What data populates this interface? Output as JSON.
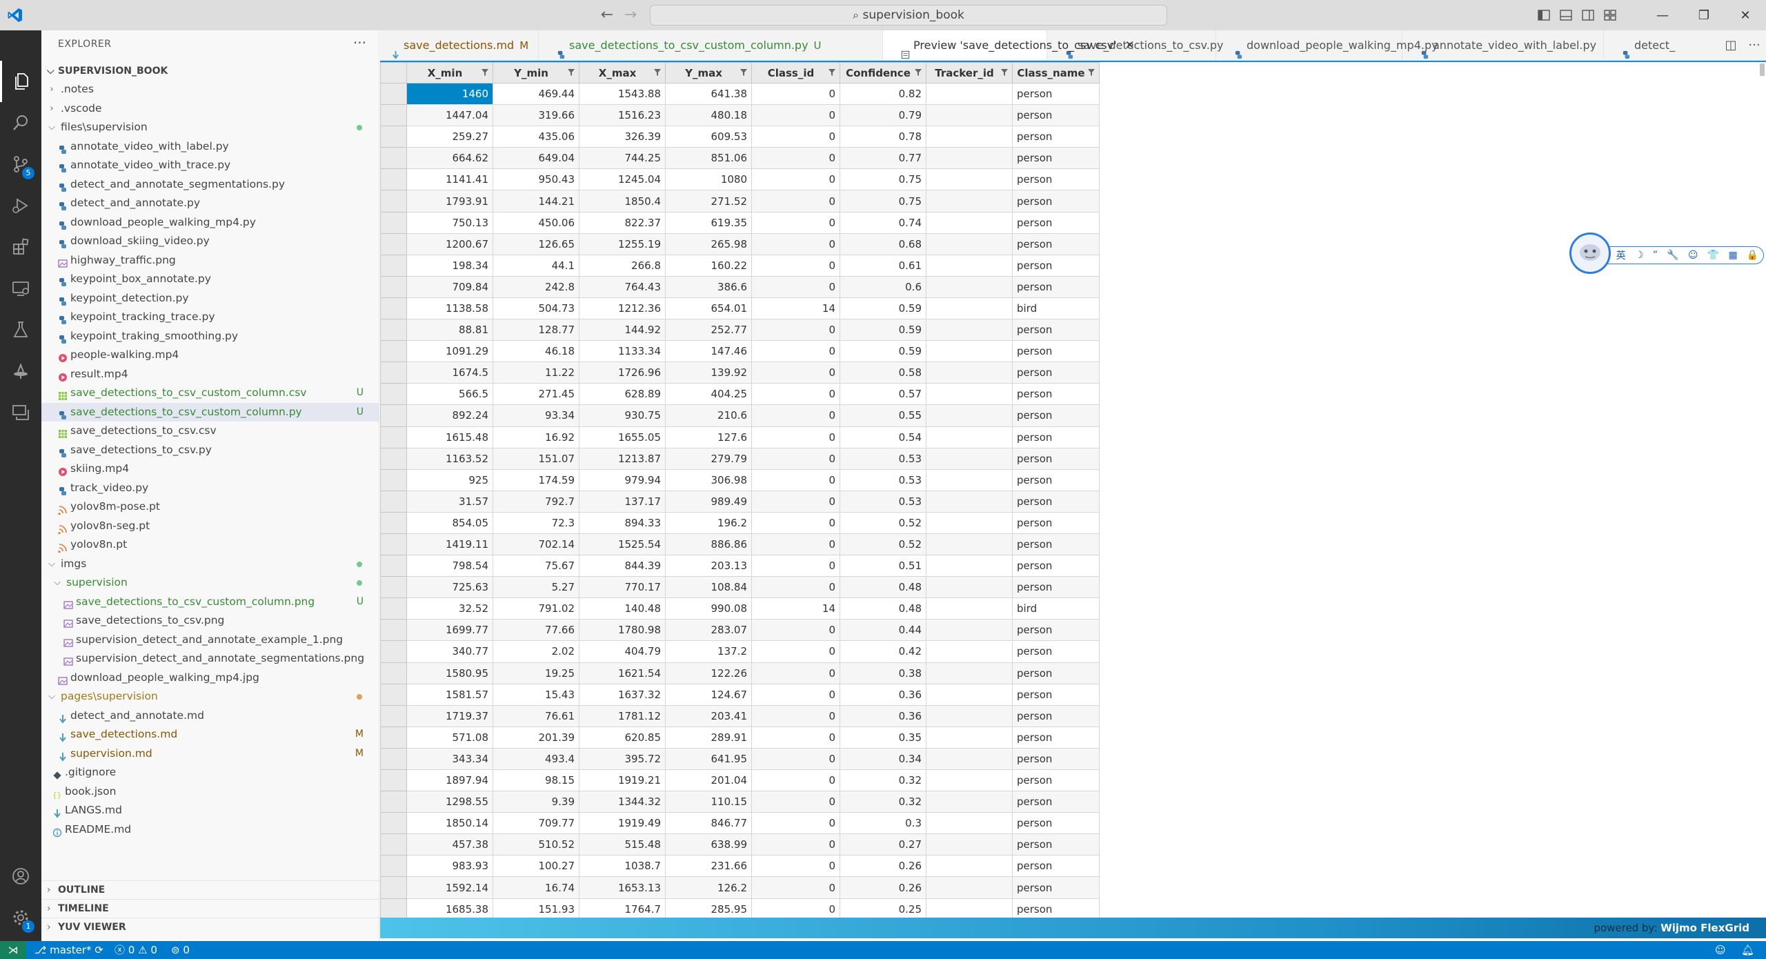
{
  "titlebar": {
    "search_text": "supervision_book"
  },
  "activity_bar": {
    "source_control_badge": "5",
    "accounts_badge": "1"
  },
  "sidebar": {
    "header": "EXPLORER",
    "more": "···",
    "workspace": "SUPERVISION_BOOK",
    "items": [
      {
        "label": ".notes",
        "type": "folder-closed",
        "level": 1
      },
      {
        "label": ".vscode",
        "type": "folder-closed",
        "level": 1
      },
      {
        "label": "files\\supervision",
        "type": "folder-open",
        "level": 1,
        "dot": "green"
      },
      {
        "label": "annotate_video_with_label.py",
        "type": "py",
        "level": 2
      },
      {
        "label": "annotate_video_with_trace.py",
        "type": "py",
        "level": 2
      },
      {
        "label": "detect_and_annotate_segmentations.py",
        "type": "py",
        "level": 2
      },
      {
        "label": "detect_and_annotate.py",
        "type": "py",
        "level": 2
      },
      {
        "label": "download_people_walking_mp4.py",
        "type": "py",
        "level": 2
      },
      {
        "label": "download_skiing_video.py",
        "type": "py",
        "level": 2
      },
      {
        "label": "highway_traffic.png",
        "type": "img",
        "level": 2
      },
      {
        "label": "keypoint_box_annotate.py",
        "type": "py",
        "level": 2
      },
      {
        "label": "keypoint_detection.py",
        "type": "py",
        "level": 2
      },
      {
        "label": "keypoint_tracking_trace.py",
        "type": "py",
        "level": 2
      },
      {
        "label": "keypoint_traking_smoothing.py",
        "type": "py",
        "level": 2
      },
      {
        "label": "people-walking.mp4",
        "type": "mp4",
        "level": 2
      },
      {
        "label": "result.mp4",
        "type": "mp4",
        "level": 2
      },
      {
        "label": "save_detections_to_csv_custom_column.csv",
        "type": "csv",
        "level": 2,
        "status": "U",
        "color": "green"
      },
      {
        "label": "save_detections_to_csv_custom_column.py",
        "type": "py",
        "level": 2,
        "status": "U",
        "color": "green",
        "selected": true
      },
      {
        "label": "save_detections_to_csv.csv",
        "type": "csv",
        "level": 2
      },
      {
        "label": "save_detections_to_csv.py",
        "type": "py",
        "level": 2
      },
      {
        "label": "skiing.mp4",
        "type": "mp4",
        "level": 2
      },
      {
        "label": "track_video.py",
        "type": "py",
        "level": 2
      },
      {
        "label": "yolov8m-pose.pt",
        "type": "pt",
        "level": 2
      },
      {
        "label": "yolov8n-seg.pt",
        "type": "pt",
        "level": 2
      },
      {
        "label": "yolov8n.pt",
        "type": "pt",
        "level": 2
      },
      {
        "label": "imgs",
        "type": "folder-open",
        "level": 1,
        "dot": "green"
      },
      {
        "label": "supervision",
        "type": "folder-open",
        "level": 2,
        "dot": "green",
        "color": "green"
      },
      {
        "label": "save_detections_to_csv_custom_column.png",
        "type": "img",
        "level": 3,
        "status": "U",
        "color": "green"
      },
      {
        "label": "save_detections_to_csv.png",
        "type": "img",
        "level": 3
      },
      {
        "label": "supervision_detect_and_annotate_example_1.png",
        "type": "img",
        "level": 3
      },
      {
        "label": "supervision_detect_and_annotate_segmentations.png",
        "type": "img",
        "level": 3
      },
      {
        "label": "download_people_walking_mp4.jpg",
        "type": "img",
        "level": 2
      },
      {
        "label": "pages\\supervision",
        "type": "folder-open",
        "level": 1,
        "dot": "mod",
        "color": "folder-mod"
      },
      {
        "label": "detect_and_annotate.md",
        "type": "md",
        "level": 2
      },
      {
        "label": "save_detections.md",
        "type": "md",
        "level": 2,
        "status": "M",
        "color": "mod"
      },
      {
        "label": "supervision.md",
        "type": "md",
        "level": 2,
        "status": "M",
        "color": "mod"
      },
      {
        "label": ".gitignore",
        "type": "git",
        "level": 1
      },
      {
        "label": "book.json",
        "type": "json",
        "level": 1
      },
      {
        "label": "LANGS.md",
        "type": "md",
        "level": 1
      },
      {
        "label": "README.md",
        "type": "info",
        "level": 1
      }
    ],
    "sections": [
      "OUTLINE",
      "TIMELINE",
      "YUV VIEWER"
    ]
  },
  "tabs": [
    {
      "label": "save_detections.md",
      "status": "M",
      "type": "md"
    },
    {
      "label": "save_detections_to_csv_custom_column.py",
      "status": "U",
      "type": "py"
    },
    {
      "label": "Preview 'save_detections_to_csv.csv'",
      "status": "",
      "type": "preview",
      "active": true
    },
    {
      "label": "save_detections_to_csv.py",
      "status": "",
      "type": "py"
    },
    {
      "label": "download_people_walking_mp4.py",
      "status": "",
      "type": "py"
    },
    {
      "label": "annotate_video_with_label.py",
      "status": "",
      "type": "py"
    },
    {
      "label": "detect_",
      "status": "",
      "type": "py"
    }
  ],
  "grid": {
    "columns": [
      "X_min",
      "Y_min",
      "X_max",
      "Y_max",
      "Class_id",
      "Confidence",
      "Tracker_id",
      "Class_name"
    ],
    "rows": [
      [
        "1460",
        "469.44",
        "1543.88",
        "641.38",
        "0",
        "0.82",
        "",
        "person"
      ],
      [
        "1447.04",
        "319.66",
        "1516.23",
        "480.18",
        "0",
        "0.79",
        "",
        "person"
      ],
      [
        "259.27",
        "435.06",
        "326.39",
        "609.53",
        "0",
        "0.78",
        "",
        "person"
      ],
      [
        "664.62",
        "649.04",
        "744.25",
        "851.06",
        "0",
        "0.77",
        "",
        "person"
      ],
      [
        "1141.41",
        "950.43",
        "1245.04",
        "1080",
        "0",
        "0.75",
        "",
        "person"
      ],
      [
        "1793.91",
        "144.21",
        "1850.4",
        "271.52",
        "0",
        "0.75",
        "",
        "person"
      ],
      [
        "750.13",
        "450.06",
        "822.37",
        "619.35",
        "0",
        "0.74",
        "",
        "person"
      ],
      [
        "1200.67",
        "126.65",
        "1255.19",
        "265.98",
        "0",
        "0.68",
        "",
        "person"
      ],
      [
        "198.34",
        "44.1",
        "266.8",
        "160.22",
        "0",
        "0.61",
        "",
        "person"
      ],
      [
        "709.84",
        "242.8",
        "764.43",
        "386.6",
        "0",
        "0.6",
        "",
        "person"
      ],
      [
        "1138.58",
        "504.73",
        "1212.36",
        "654.01",
        "14",
        "0.59",
        "",
        "bird"
      ],
      [
        "88.81",
        "128.77",
        "144.92",
        "252.77",
        "0",
        "0.59",
        "",
        "person"
      ],
      [
        "1091.29",
        "46.18",
        "1133.34",
        "147.46",
        "0",
        "0.59",
        "",
        "person"
      ],
      [
        "1674.5",
        "11.22",
        "1726.96",
        "139.92",
        "0",
        "0.58",
        "",
        "person"
      ],
      [
        "566.5",
        "271.45",
        "628.89",
        "404.25",
        "0",
        "0.57",
        "",
        "person"
      ],
      [
        "892.24",
        "93.34",
        "930.75",
        "210.6",
        "0",
        "0.55",
        "",
        "person"
      ],
      [
        "1615.48",
        "16.92",
        "1655.05",
        "127.6",
        "0",
        "0.54",
        "",
        "person"
      ],
      [
        "1163.52",
        "151.07",
        "1213.87",
        "279.79",
        "0",
        "0.53",
        "",
        "person"
      ],
      [
        "925",
        "174.59",
        "979.94",
        "306.98",
        "0",
        "0.53",
        "",
        "person"
      ],
      [
        "31.57",
        "792.7",
        "137.17",
        "989.49",
        "0",
        "0.53",
        "",
        "person"
      ],
      [
        "854.05",
        "72.3",
        "894.33",
        "196.2",
        "0",
        "0.52",
        "",
        "person"
      ],
      [
        "1419.11",
        "702.14",
        "1525.54",
        "886.86",
        "0",
        "0.52",
        "",
        "person"
      ],
      [
        "798.54",
        "75.67",
        "844.39",
        "203.13",
        "0",
        "0.51",
        "",
        "person"
      ],
      [
        "725.63",
        "5.27",
        "770.17",
        "108.84",
        "0",
        "0.48",
        "",
        "person"
      ],
      [
        "32.52",
        "791.02",
        "140.48",
        "990.08",
        "14",
        "0.48",
        "",
        "bird"
      ],
      [
        "1699.77",
        "77.66",
        "1780.98",
        "283.07",
        "0",
        "0.44",
        "",
        "person"
      ],
      [
        "340.77",
        "2.02",
        "404.79",
        "137.2",
        "0",
        "0.42",
        "",
        "person"
      ],
      [
        "1580.95",
        "19.25",
        "1621.54",
        "122.26",
        "0",
        "0.38",
        "",
        "person"
      ],
      [
        "1581.57",
        "15.43",
        "1637.32",
        "124.67",
        "0",
        "0.36",
        "",
        "person"
      ],
      [
        "1719.37",
        "76.61",
        "1781.12",
        "203.41",
        "0",
        "0.36",
        "",
        "person"
      ],
      [
        "571.08",
        "201.39",
        "620.85",
        "289.91",
        "0",
        "0.35",
        "",
        "person"
      ],
      [
        "343.34",
        "493.4",
        "395.72",
        "641.95",
        "0",
        "0.34",
        "",
        "person"
      ],
      [
        "1897.94",
        "98.15",
        "1919.21",
        "201.04",
        "0",
        "0.32",
        "",
        "person"
      ],
      [
        "1298.55",
        "9.39",
        "1344.32",
        "110.15",
        "0",
        "0.32",
        "",
        "person"
      ],
      [
        "1850.14",
        "709.77",
        "1919.49",
        "846.77",
        "0",
        "0.3",
        "",
        "person"
      ],
      [
        "457.38",
        "510.52",
        "515.48",
        "638.99",
        "0",
        "0.27",
        "",
        "person"
      ],
      [
        "983.93",
        "100.27",
        "1038.7",
        "231.66",
        "0",
        "0.26",
        "",
        "person"
      ],
      [
        "1592.14",
        "16.74",
        "1653.13",
        "126.2",
        "0",
        "0.26",
        "",
        "person"
      ],
      [
        "1685.38",
        "151.93",
        "1764.7",
        "285.95",
        "0",
        "0.25",
        "",
        "person"
      ]
    ],
    "footer_prefix": "powered by:",
    "footer_brand": "Wijmo FlexGrid"
  },
  "float_toolbar": {
    "lang": "英",
    "glyphs": [
      "☽",
      "”",
      "🔧",
      "☺",
      "👕",
      "▦",
      "🔒"
    ]
  },
  "statusbar": {
    "branch": "master*",
    "errors": "0",
    "warnings": "0",
    "ports": "0"
  },
  "colors": {
    "accent": "#007acc",
    "selected_cell": "#0085c7",
    "untracked": "#388a34",
    "modified": "#895503"
  }
}
